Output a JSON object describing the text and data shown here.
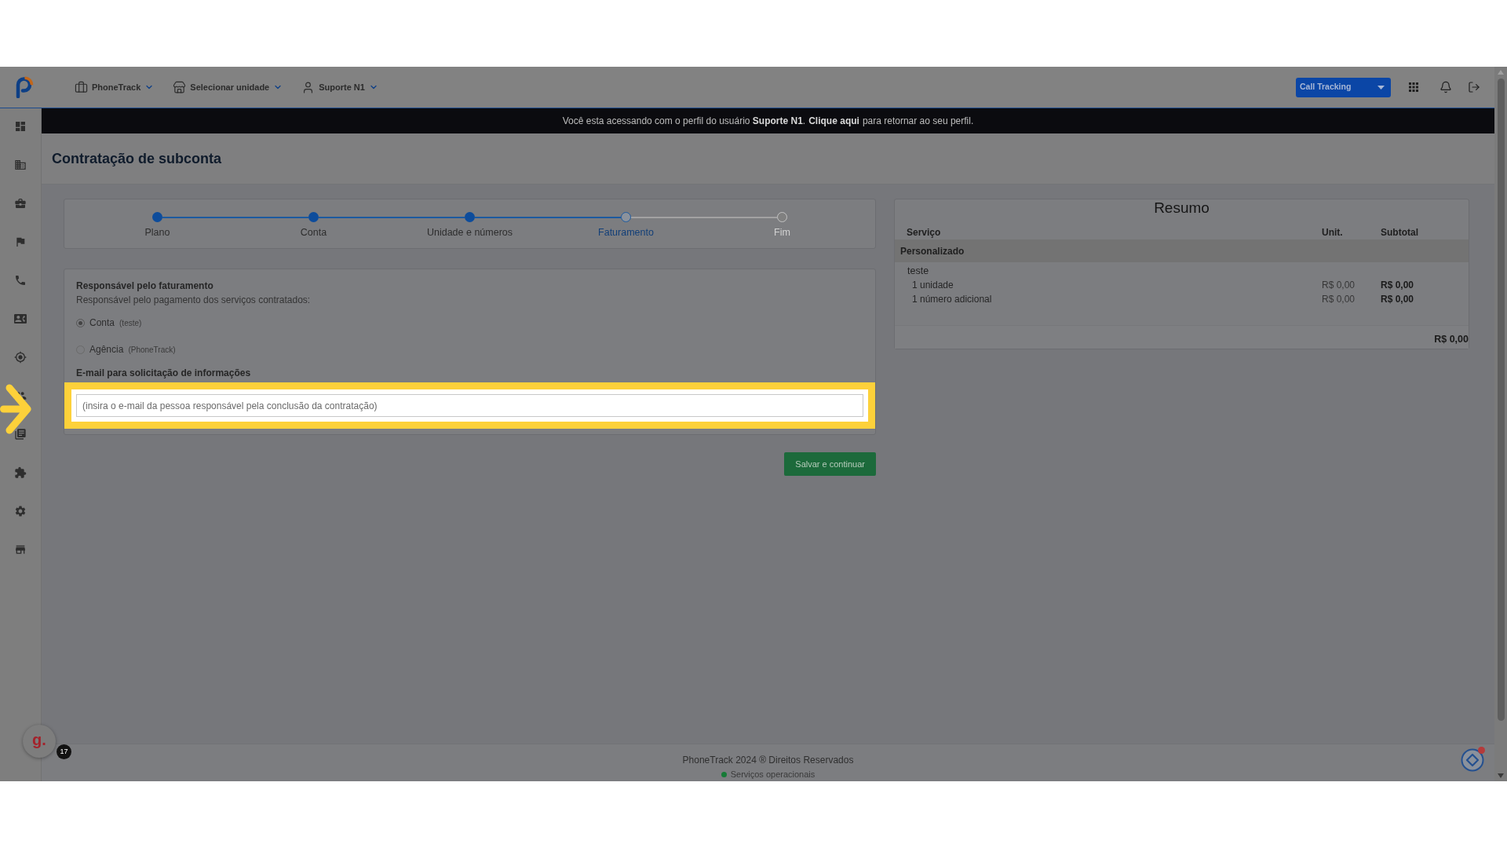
{
  "header": {
    "menus": [
      {
        "label": "PhoneTrack"
      },
      {
        "label": "Selecionar unidade"
      },
      {
        "label": "Suporte N1"
      }
    ],
    "product_select": {
      "value": "Call Tracking"
    }
  },
  "impersonation_banner": {
    "text": "Você esta acessando com o perfil do usuário **Suporte N1**.",
    "link": "Clique aqui",
    "after": "para retornar ao seu perfil."
  },
  "page": {
    "title": "Contratação de subconta"
  },
  "stepper": {
    "steps": [
      {
        "label": "Plano",
        "completed": true,
        "selected": false
      },
      {
        "label": "Conta",
        "completed": true,
        "selected": false
      },
      {
        "label": "Unidade e números",
        "completed": true,
        "selected": false
      },
      {
        "label": "Faturamento",
        "completed": false,
        "selected": true
      },
      {
        "label": "Fim",
        "completed": false,
        "selected": false
      }
    ]
  },
  "billing": {
    "title": "Responsável pelo faturamento",
    "subtitle": "Responsável pelo pagamento dos serviços contratados:",
    "options": [
      {
        "label": "Conta",
        "detail": "(teste)",
        "selected": true
      },
      {
        "label": "Agência",
        "detail": "(PhoneTrack)",
        "selected": false
      }
    ],
    "email": {
      "label": "E-mail para solicitação de informações",
      "placeholder": "(insira o e-mail da pessoa responsável pela conclusão da contratação)",
      "highlighted": true
    }
  },
  "save_button": {
    "label": "Salvar e continuar"
  },
  "summary": {
    "title": "Resumo",
    "columns": [
      "Serviço",
      "Unit.",
      "Subtotal"
    ],
    "groups": [
      {
        "name": "Personalizado",
        "account": "teste",
        "rows": [
          {
            "item": "1 unidade",
            "unit": "R$ 0,00",
            "subtotal": "R$ 0,00"
          },
          {
            "item": "1 número adicional",
            "unit": "R$ 0,00",
            "subtotal": "R$ 0,00"
          }
        ]
      }
    ],
    "total": "R$ 0,00"
  },
  "footer": {
    "copyright": "PhoneTrack 2024 ® Direitos Reservados",
    "status": "Serviços operacionais"
  },
  "widgets": {
    "assistant": {
      "label": "g.",
      "badge": "17"
    }
  }
}
